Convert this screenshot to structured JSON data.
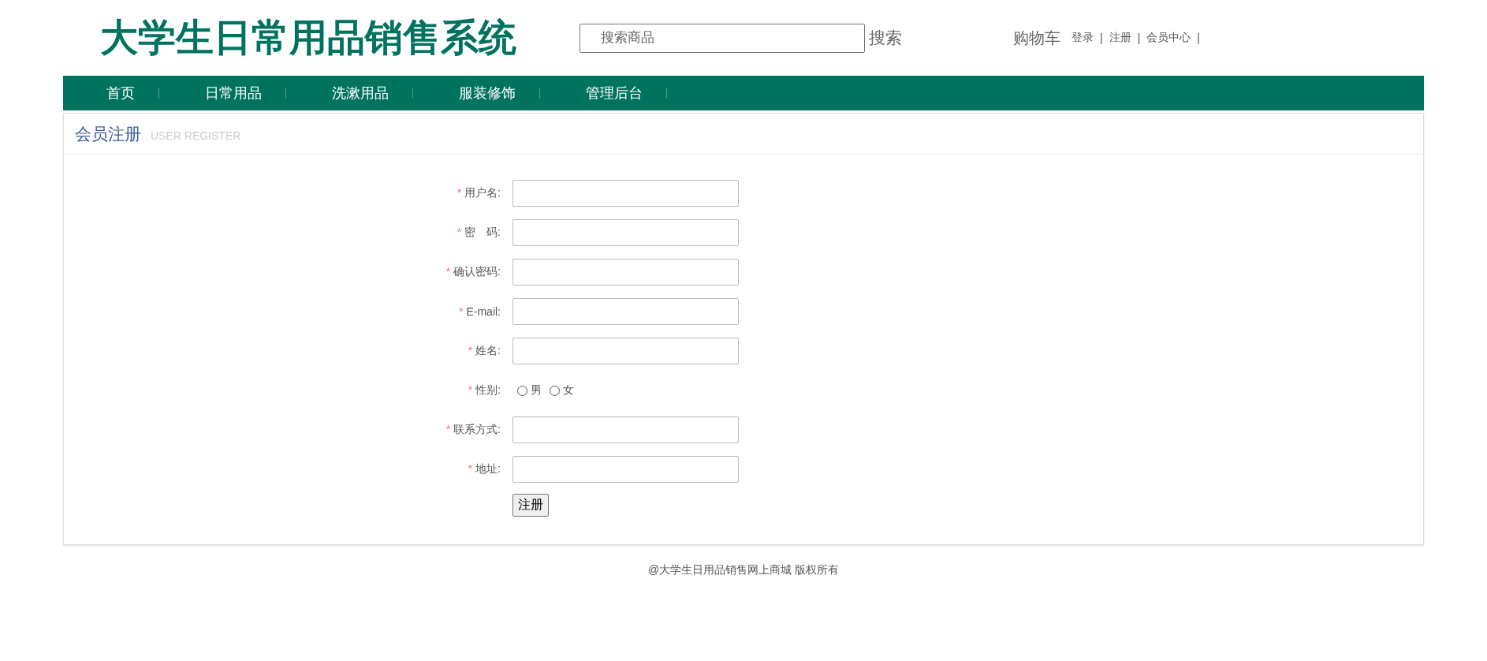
{
  "header": {
    "logo": "大学生日常用品销售系统",
    "search": {
      "placeholder": "搜索商品",
      "button": "搜索"
    },
    "cart": "购物车",
    "links": [
      {
        "kind": "link",
        "text": "登录"
      },
      {
        "kind": "separator",
        "text": "|"
      },
      {
        "kind": "link",
        "text": "注册"
      },
      {
        "kind": "separator",
        "text": "|"
      },
      {
        "kind": "link",
        "text": "会员中心"
      },
      {
        "kind": "separator",
        "text": "|"
      }
    ]
  },
  "nav": {
    "items": [
      "首页",
      "日常用品",
      "洗漱用品",
      "服装修饰",
      "管理后台"
    ]
  },
  "panel": {
    "title": "会员注册",
    "subtitle": "USER REGISTER",
    "fields": [
      {
        "kind": "text",
        "mark": "*",
        "label": "用户名:"
      },
      {
        "kind": "text",
        "mark": "*",
        "label": "密　码:"
      },
      {
        "kind": "text",
        "mark": "*",
        "label": "确认密码:"
      },
      {
        "kind": "text",
        "mark": "*",
        "label": "E-mail:"
      },
      {
        "kind": "text",
        "mark": "*",
        "label": "姓名:"
      },
      {
        "kind": "radio",
        "mark": "*",
        "label": "性别:",
        "options": [
          {
            "label": "男",
            "selected": false
          },
          {
            "label": "女",
            "selected": false
          }
        ]
      },
      {
        "kind": "text",
        "mark": "*",
        "label": "联系方式:"
      },
      {
        "kind": "text",
        "mark": "*",
        "label": "地址:"
      }
    ],
    "submit": "注册"
  },
  "footer": "@大学生日用品销售网上商城 版权所有"
}
